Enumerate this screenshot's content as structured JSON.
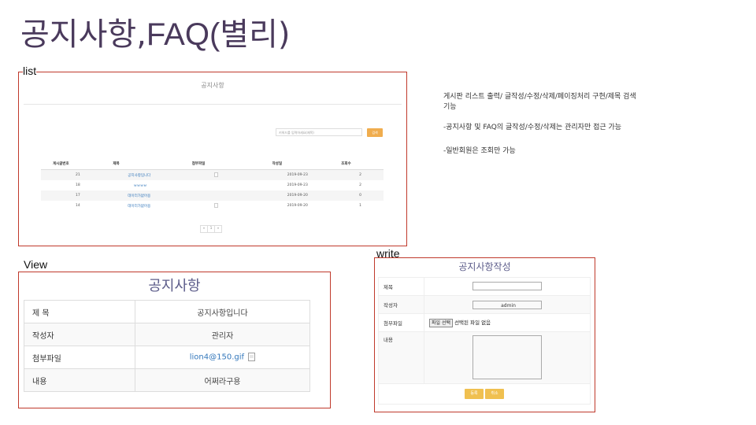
{
  "slide": {
    "title_korean_1": "공지사항,",
    "title_latin": "FAQ(",
    "title_korean_2": "별리)"
  },
  "labels": {
    "list": "list",
    "view": "View",
    "write": "write"
  },
  "list_panel": {
    "title": "공지사항",
    "search_placeholder": "키워드를 입력하세요(제목)",
    "search_button": "검색",
    "columns": [
      "게시글번호",
      "제목",
      "첨부파일",
      "작성일",
      "조회수"
    ],
    "rows": [
      {
        "no": "21",
        "title": "공지사항입니다",
        "attach_icon": "file-icon",
        "date": "2019-09-23",
        "views": "2"
      },
      {
        "no": "18",
        "title": "ㅂㅂㅂㅂ",
        "attach_icon": "",
        "date": "2019-09-23",
        "views": "2"
      },
      {
        "no": "17",
        "title": "데이터가없어용",
        "attach_icon": "",
        "date": "2019-09-20",
        "views": "0"
      },
      {
        "no": "14",
        "title": "데이터가없어용",
        "attach_icon": "file-icon",
        "date": "2019-09-20",
        "views": "1"
      }
    ],
    "pagination": [
      "«",
      "1",
      "»"
    ]
  },
  "description": {
    "line1": "게시판 리스트 출력/ 글작성/수정/삭제/페이징처리 구현/제목 검색",
    "line1b": "기능",
    "line2": "-공지사항 및 FAQ의 글작성/수정/삭제는 관리자만 접근 가능",
    "line3": "-일반회원은 조회만 가능"
  },
  "view_panel": {
    "title": "공지사항",
    "rows": [
      {
        "label": "제 목",
        "value": "공지사항입니다"
      },
      {
        "label": "작성자",
        "value": "관리자"
      },
      {
        "label": "첨부파일",
        "value": "lion4@150.gif"
      },
      {
        "label": "내용",
        "value": "어쩌라구용"
      }
    ]
  },
  "write_panel": {
    "title": "공지사항작성",
    "labels": {
      "title": "제목",
      "author": "작성자",
      "attachment": "첨부파일",
      "content": "내용"
    },
    "title_value": "",
    "author_value": "admin",
    "file_button": "파일 선택",
    "file_status": "선택된 파일 없음",
    "submit_button": "등록",
    "cancel_button": "취소"
  },
  "colors": {
    "frame_border": "#c0392b",
    "accent_orange": "#f0ad4e",
    "accent_yellow": "#f0c050",
    "link_blue": "#3377bb",
    "title_purple": "#4a3a5c"
  }
}
